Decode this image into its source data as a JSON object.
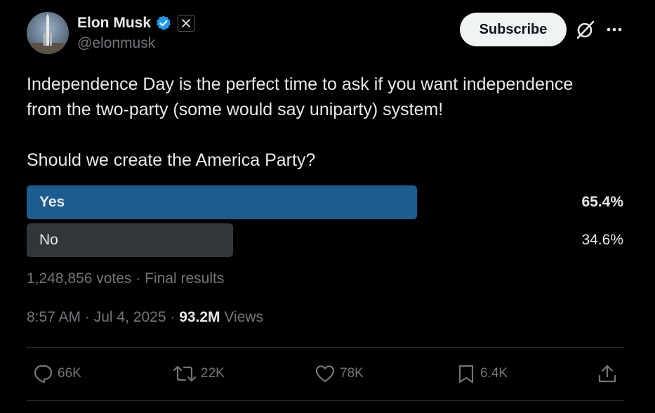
{
  "author": {
    "display_name": "Elon Musk",
    "handle": "@elonmusk",
    "verified": true,
    "affiliation_icon": "x-logo-icon"
  },
  "header": {
    "subscribe_label": "Subscribe",
    "grok_icon": "grok-icon",
    "more_icon": "more-icon"
  },
  "tweet": {
    "text_line1": "Independence Day is the perfect time to ask if you want independence",
    "text_line2": "from the two-party (some would say uniparty) system!",
    "question": "Should we create the America Party?"
  },
  "poll": {
    "options": [
      {
        "label": "Yes",
        "percent_text": "65.4%",
        "percent": 65.4,
        "winner": true,
        "color": "#1d5c8f"
      },
      {
        "label": "No",
        "percent_text": "34.6%",
        "percent": 34.6,
        "winner": false,
        "color": "#333639"
      }
    ],
    "votes": "1,248,856 votes",
    "separator": "·",
    "status": "Final results"
  },
  "meta": {
    "time": "8:57 AM",
    "date": "Jul 4, 2025",
    "separator": "·",
    "views_count": "93.2M",
    "views_label": "Views"
  },
  "actions": {
    "replies": "66K",
    "reposts": "22K",
    "likes": "78K",
    "bookmarks": "6.4K"
  },
  "colors": {
    "background": "#000000",
    "text": "#e7e9ea",
    "muted": "#71767b",
    "verified_blue": "#1d9bf0",
    "divider": "#2f3336"
  }
}
